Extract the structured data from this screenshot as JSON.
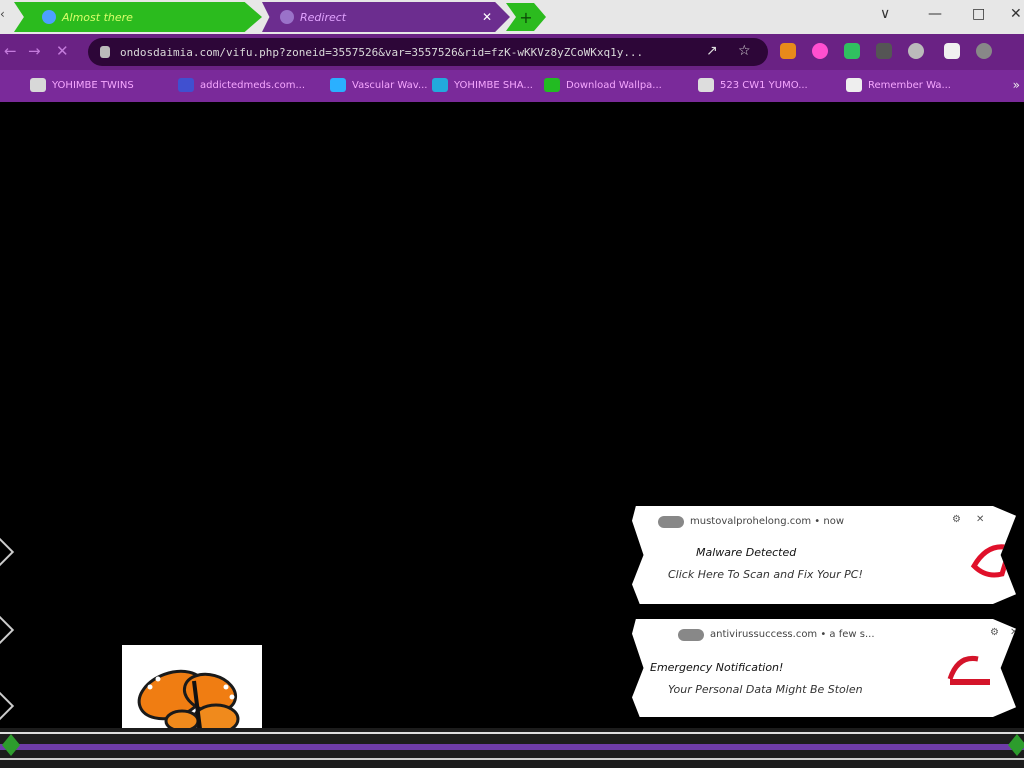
{
  "tabs": [
    {
      "label": "Almost there",
      "active": true
    },
    {
      "label": "Redirect",
      "active": false
    }
  ],
  "window": {
    "minimize": "∨",
    "restore": "—",
    "maximize": "□",
    "close": "✕"
  },
  "address": {
    "url": "ondosdaimia.com/vifu.php?zoneid=3557526&var=3557526&rid=fzK-wKKVz8yZCoWKxq1y..."
  },
  "bookmarks": [
    {
      "label": "YOHIMBE TWINS",
      "color": "#d8d8d8"
    },
    {
      "label": "addictedmeds.com...",
      "color": "#4050d0"
    },
    {
      "label": "Vascular Wav...",
      "color": "#2ab0ff"
    },
    {
      "label": "YOHIMBE SHA...",
      "color": "#22aadd"
    },
    {
      "label": "Download Wallpa...",
      "color": "#22bb22"
    },
    {
      "label": "523 CW1 YUMO...",
      "color": "#dddddd"
    },
    {
      "label": "Remember Wa...",
      "color": "#eeeeee"
    }
  ],
  "notifications": [
    {
      "source": "mustovalprohelong.com • now",
      "title": "Malware Detected",
      "body": "Click Here To Scan and Fix Your PC!",
      "brand_color": "#e0102a"
    },
    {
      "source": "antivirussuccess.com • a few s...",
      "title": "Emergency Notification!",
      "body": "Your Personal Data Might Be Stolen",
      "brand_color": "#d4142a"
    }
  ],
  "colors": {
    "tab_active": "#2bbb1e",
    "toolbar": "#6a2284",
    "bookmarks_bar": "#7a2a9a",
    "content_bg": "#000000"
  }
}
